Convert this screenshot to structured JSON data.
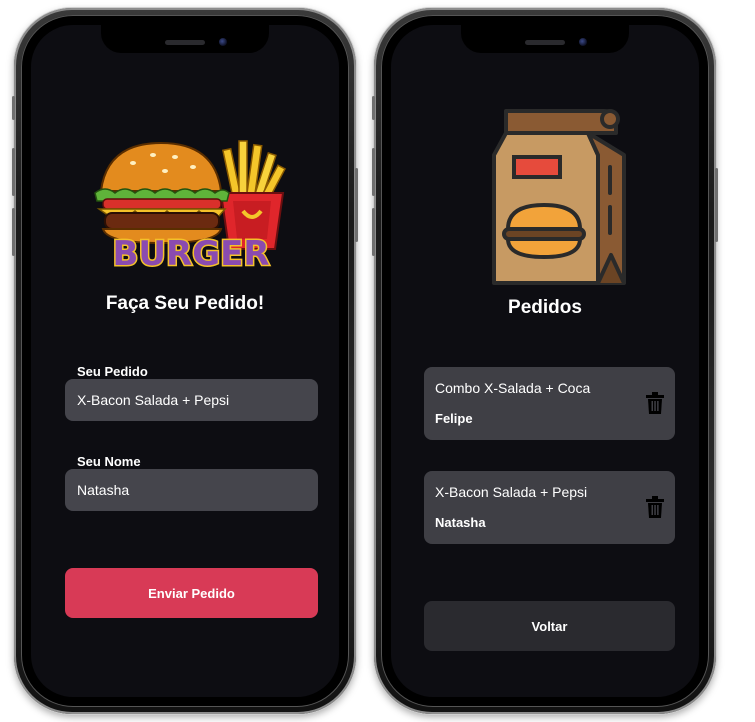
{
  "order_screen": {
    "logo_text": "BURGER",
    "title": "Faça Seu Pedido!",
    "order_field": {
      "label": "Seu Pedido",
      "value": "X-Bacon Salada + Pepsi"
    },
    "name_field": {
      "label": "Seu Nome",
      "value": "Natasha"
    },
    "submit_label": "Enviar Pedido"
  },
  "orders_screen": {
    "title": "Pedidos",
    "orders": [
      {
        "description": "Combo X-Salada + Coca",
        "customer": "Felipe"
      },
      {
        "description": "X-Bacon Salada + Pepsi",
        "customer": "Natasha"
      }
    ],
    "back_label": "Voltar"
  },
  "colors": {
    "screen_bg": "#0d0d12",
    "input_bg": "#45454c",
    "card_bg": "#3f3f45",
    "accent": "#d83a56",
    "secondary_button": "#2a2a2f"
  }
}
